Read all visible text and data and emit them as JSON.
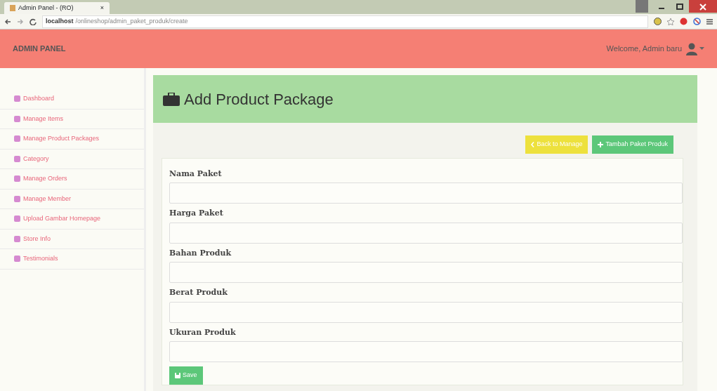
{
  "browser": {
    "tab_title": "Admin Panel - (RO)",
    "tab_close": "×",
    "url_host": "localhost",
    "url_path": "/onlineshop/admin_paket_produk/create"
  },
  "navbar": {
    "brand": "ADMIN PANEL",
    "welcome": "Welcome, Admin baru"
  },
  "sidebar": {
    "items": [
      {
        "label": "Dashboard",
        "selected": false
      },
      {
        "label": "Manage Items",
        "selected": false
      },
      {
        "label": "Manage Product Packages",
        "selected": false
      },
      {
        "label": "Category",
        "selected": false
      },
      {
        "label": "Manage Orders",
        "selected": false
      },
      {
        "label": "Manage Member",
        "selected": false
      },
      {
        "label": "Upload Gambar Homepage",
        "selected": false
      },
      {
        "label": "Store Info",
        "selected": false
      },
      {
        "label": "Testimonials",
        "selected": false
      }
    ]
  },
  "page": {
    "title": "Add Product Package",
    "back_button": "Back to Manage",
    "add_button": "Tambah Paket Produk",
    "fields": [
      {
        "label": "Nama Paket"
      },
      {
        "label": "Harga Paket"
      },
      {
        "label": "Bahan Produk"
      },
      {
        "label": "Berat Produk"
      },
      {
        "label": "Ukuran Produk"
      }
    ],
    "save_button": "Save"
  }
}
